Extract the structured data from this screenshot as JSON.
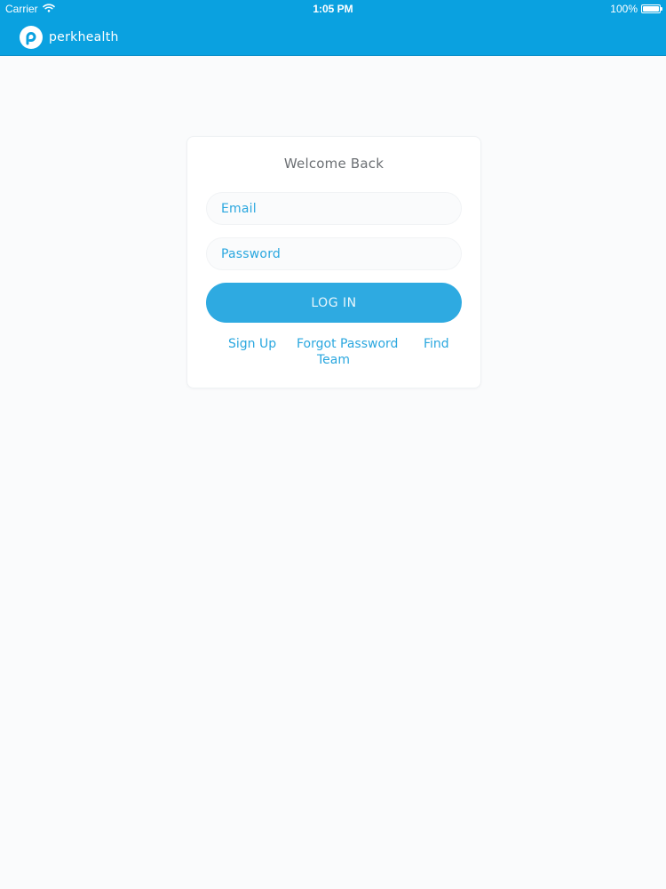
{
  "status_bar": {
    "carrier": "Carrier",
    "time": "1:05 PM",
    "battery_percent": "100%",
    "battery_level": 1.0,
    "icons": [
      "wifi-icon",
      "battery-icon"
    ]
  },
  "nav": {
    "brand_name": "perkhealth",
    "logo_icon": "perkhealth-logo-icon"
  },
  "login": {
    "title": "Welcome Back",
    "email_placeholder": "Email",
    "password_placeholder": "Password",
    "login_label": "LOG IN",
    "links": {
      "sign_up": "Sign Up",
      "forgot_password": "Forgot Password",
      "find": "Find",
      "team": "Team"
    }
  },
  "colors": {
    "brand_blue": "#0aa1e0",
    "button_blue": "#2eaae1",
    "link_blue": "#2aa7df",
    "background": "#fafbfc",
    "title_gray": "#6b6f73"
  }
}
